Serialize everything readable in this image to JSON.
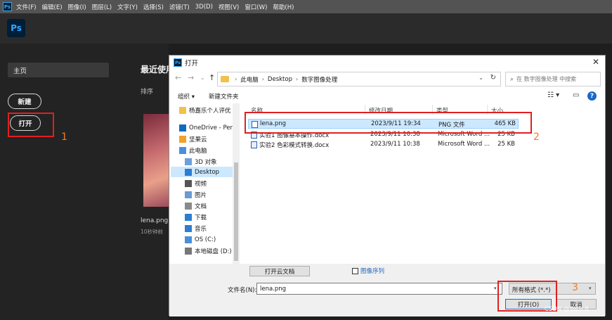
{
  "ps_menubar": {
    "logo": "Ps",
    "items": [
      "文件(F)",
      "编辑(E)",
      "图像(I)",
      "图层(L)",
      "文字(Y)",
      "选择(S)",
      "滤镜(T)",
      "3D(D)",
      "视图(V)",
      "窗口(W)",
      "帮助(H)"
    ]
  },
  "ps_home": {
    "logo": "Ps",
    "home_label": "主页",
    "new_label": "新建",
    "open_label": "打开",
    "recent_title": "最近使用",
    "sort_label": "排序",
    "recent_file_name": "lena.png",
    "recent_file_time": "10秒钟前"
  },
  "annotations": [
    "1",
    "2",
    "3"
  ],
  "dialog": {
    "title": "打开",
    "close": "✕",
    "nav": {
      "back": "←",
      "forward": "→",
      "dropdown": "⌄",
      "up": "↑"
    },
    "breadcrumb": [
      "此电脑",
      "Desktop",
      "数字图像处理"
    ],
    "refresh": "↻",
    "search_placeholder": "在 数字图像处理 中搜索",
    "toolbar": {
      "organize": "组织 ▾",
      "new_folder": "新建文件夹"
    },
    "nav_items": [
      {
        "label": "杨嘉乐个人评优",
        "icon": "folder-icon",
        "color": "#f1c24b"
      },
      {
        "label": "OneDrive - Perso",
        "icon": "cloud-icon",
        "color": "#0f6cbd"
      },
      {
        "label": "坚果云",
        "icon": "nut-icon",
        "color": "#f2a12a"
      },
      {
        "label": "此电脑",
        "icon": "computer-icon",
        "color": "#4a90d9"
      },
      {
        "label": "3D 对象",
        "icon": "cube-icon",
        "color": "#6ca0dc"
      },
      {
        "label": "Desktop",
        "icon": "desktop-icon",
        "color": "#2d7dd2"
      },
      {
        "label": "视频",
        "icon": "video-icon",
        "color": "#555555"
      },
      {
        "label": "图片",
        "icon": "picture-icon",
        "color": "#6b9bd1"
      },
      {
        "label": "文档",
        "icon": "document-icon",
        "color": "#8a8a8a"
      },
      {
        "label": "下载",
        "icon": "download-icon",
        "color": "#2d7dd2"
      },
      {
        "label": "音乐",
        "icon": "music-icon",
        "color": "#2d7dd2"
      },
      {
        "label": "OS (C:)",
        "icon": "drive-icon",
        "color": "#4a90d9"
      },
      {
        "label": "本地磁盘 (D:)",
        "icon": "drive-icon",
        "color": "#777777"
      }
    ],
    "columns": [
      "名称",
      "修改日期",
      "类型",
      "大小"
    ],
    "files": [
      {
        "name": "lena.png",
        "date": "2023/9/11 19:34",
        "type": "PNG 文件",
        "size": "465 KB",
        "selected": true
      },
      {
        "name": "实验1 图像基本操作.docx",
        "date": "2023/9/11 10:38",
        "type": "Microsoft Word ...",
        "size": "25 KB",
        "selected": false
      },
      {
        "name": "实验2 色彩模式转换.docx",
        "date": "2023/9/11 10:38",
        "type": "Microsoft Word ...",
        "size": "25 KB",
        "selected": false
      }
    ],
    "open_cloud_button": "打开云文档",
    "image_sequence_label": "图像序列",
    "filename_label": "文件名(N):",
    "filename_value": "lena.png",
    "filter_value": "所有格式 (*.*)",
    "open_button": "打开(O)",
    "cancel_button": "取消"
  },
  "watermark": "CSDN @YoLo 8",
  "colors": {
    "annotation_box": "#e02020",
    "annotation_number": "#ef7d22",
    "selection": "#cce8ff"
  }
}
